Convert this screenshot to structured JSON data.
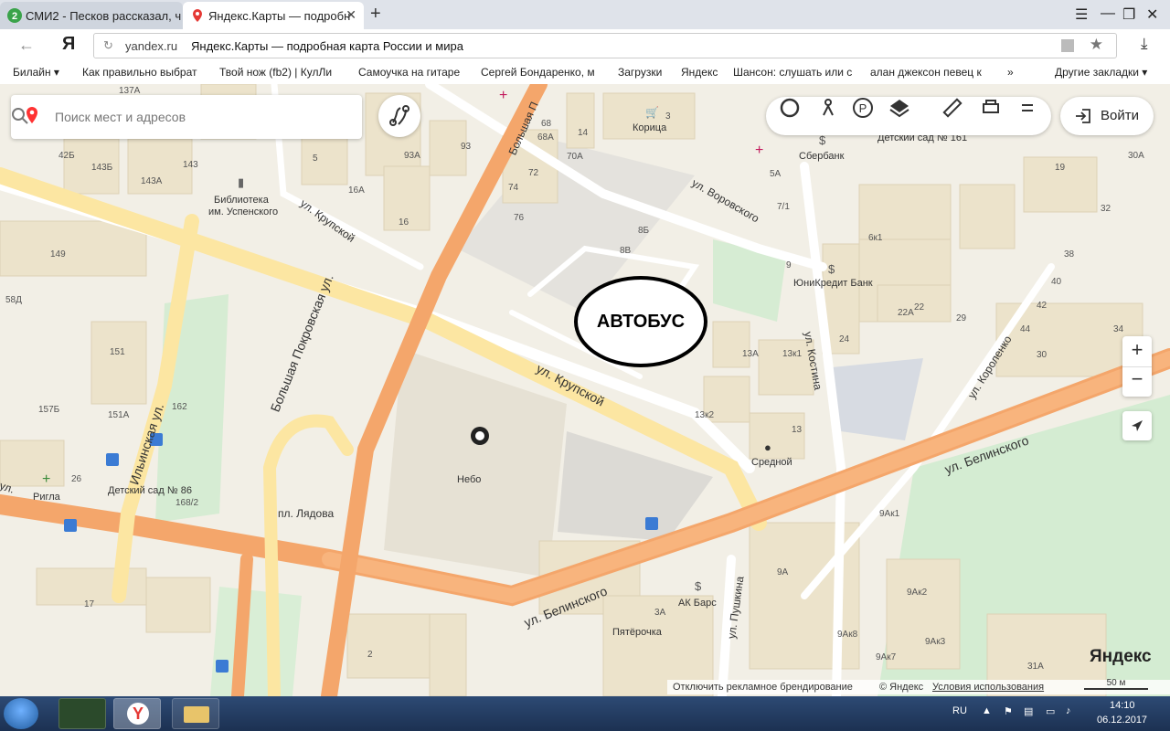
{
  "browser": {
    "tabs": [
      {
        "label": "СМИ2 - Песков рассказал, ч"
      },
      {
        "label": "Яндекс.Карты — подробн"
      }
    ],
    "address": {
      "domain": "yandex.ru",
      "page_title": "Яндекс.Карты — подробная карта России и мира"
    },
    "bookmarks": [
      "Билайн ▾",
      "Как правильно выбрат",
      "Твой нож (fb2) | КулЛи",
      "Самоучка на гитаре",
      "Сергей Бондаренко, м",
      "Загрузки",
      "Яндекс",
      "Шансон: слушать или с",
      "алан джексон певец к",
      "»",
      "Другие закладки ▾"
    ]
  },
  "map_ui": {
    "search_placeholder": "Поиск мест и адресов",
    "login_label": "Войти",
    "zoom_in": "+",
    "zoom_out": "−",
    "brand": "Яндекс",
    "disable_branding": "Отключить рекламное брендирование",
    "copyright": "© Яндекс",
    "terms": "Условия использования",
    "scale": "50 м",
    "toolbar_icons": [
      "traffic-icon",
      "panorama-icon",
      "parking-icon",
      "layers-icon",
      "ruler-icon",
      "print-icon",
      "menu-icon"
    ]
  },
  "annotation": {
    "text": "АВТОБУС"
  },
  "streets": [
    "Большая Покровская ул.",
    "ул. Крупской",
    "ул. Белинского",
    "ул. Белинского",
    "Ильинская ул.",
    "ул. Костина",
    "ул. Пушкина",
    "ул. Короленко",
    "ул. Воровского",
    "ул. Крупской",
    "Большая П",
    "пл. Лядова",
    "ул."
  ],
  "poi": [
    "Библиотека",
    "им. Успенского",
    "Корица",
    "Сбербанк",
    "ЮниКредит Банк",
    "Детский сад № 161",
    "Небо",
    "Средной",
    "Детский сад № 86",
    "Ригла",
    "АК Барс",
    "Пятёрочка",
    "АК Барс"
  ],
  "house_numbers": [
    "42Б",
    "143Б",
    "143",
    "143А",
    "149",
    "58Д",
    "151",
    "162",
    "157Б",
    "151А",
    "26",
    "168/2",
    "17",
    "2",
    "93",
    "93А",
    "16",
    "16А",
    "5",
    "68",
    "68А",
    "14",
    "70А",
    "72",
    "74",
    "76",
    "3",
    "8Б",
    "8В",
    "5А",
    "7/1",
    "9",
    "6к1",
    "30А",
    "19",
    "32",
    "38",
    "40",
    "42",
    "44",
    "34",
    "30",
    "22",
    "22А",
    "29",
    "24",
    "13А",
    "13к1",
    "13к2",
    "13",
    "9Ак1",
    "9А",
    "9Ак2",
    "9Ак3",
    "9Ак8",
    "9Ак7",
    "31А",
    "3А",
    "137А"
  ],
  "system": {
    "lang": "RU",
    "time": "14:10",
    "date": "06.12.2017"
  }
}
